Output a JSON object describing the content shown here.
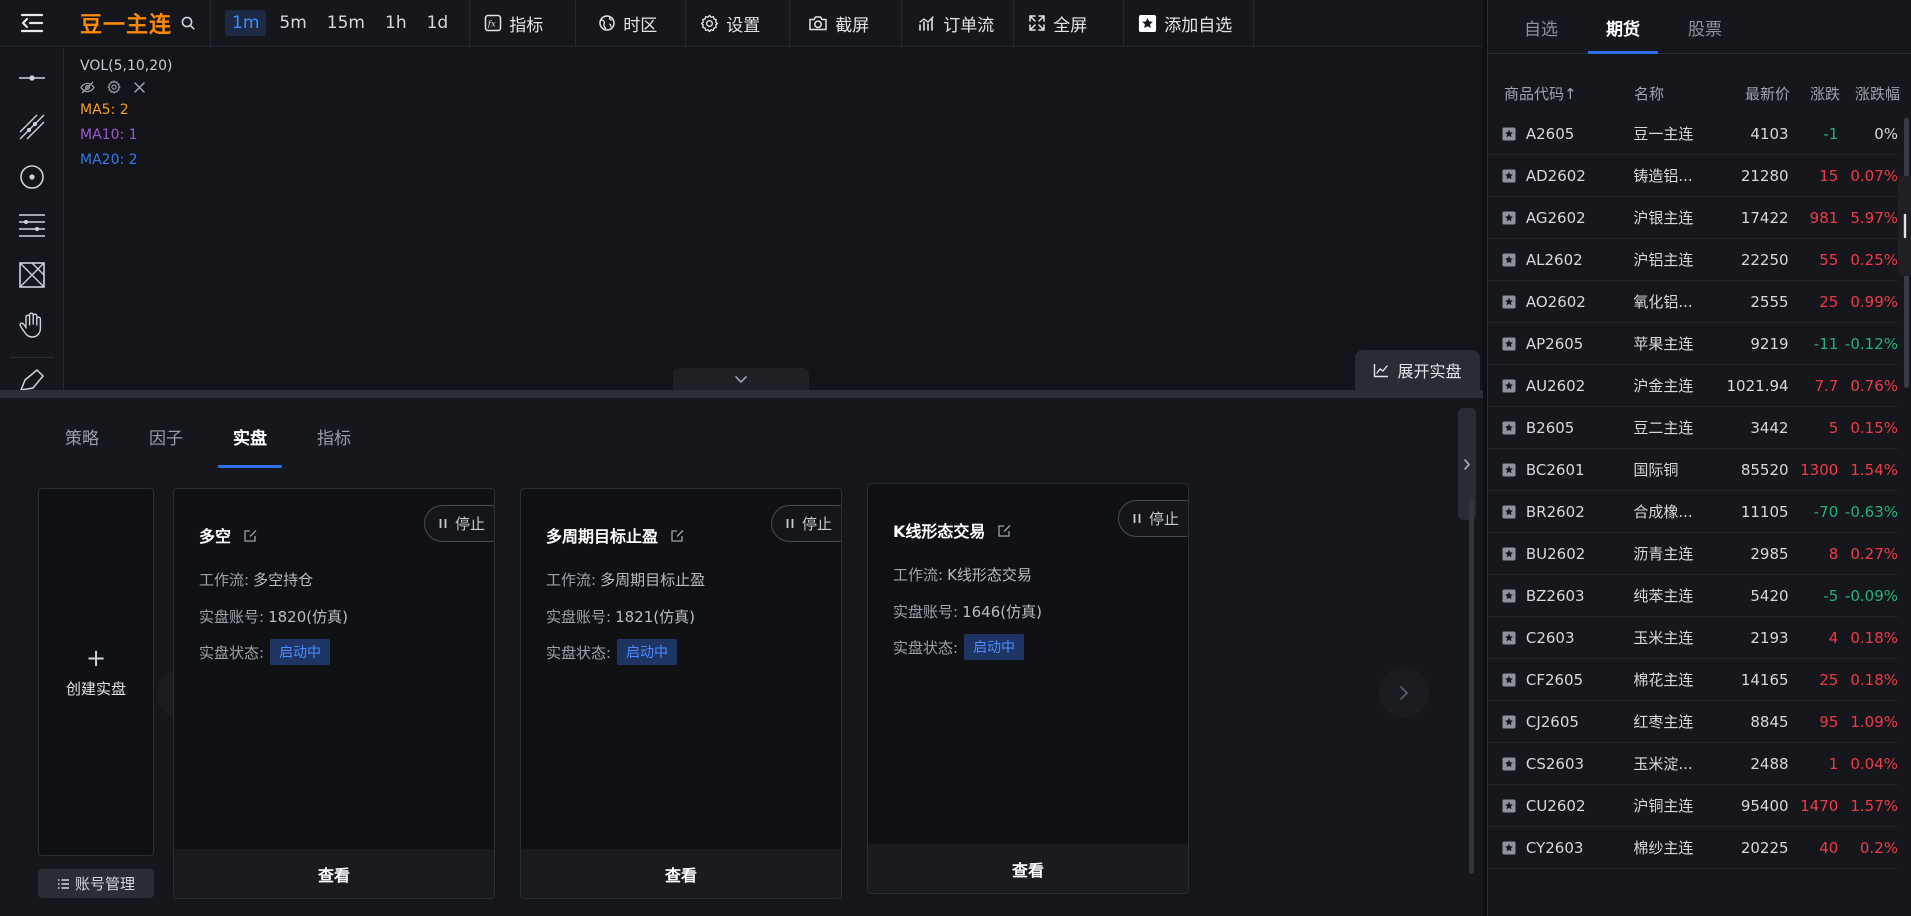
{
  "toolbar": {
    "symbol": "豆一主连",
    "intervals": [
      {
        "label": "1m",
        "active": true
      },
      {
        "label": "5m",
        "active": false
      },
      {
        "label": "15m",
        "active": false
      },
      {
        "label": "1h",
        "active": false
      },
      {
        "label": "1d",
        "active": false
      }
    ],
    "indicator_label": "指标",
    "timezone_label": "时区",
    "settings_label": "设置",
    "screenshot_label": "截屏",
    "orderflow_label": "订单流",
    "fullscreen_label": "全屏",
    "add_watch_label": "添加自选"
  },
  "chart": {
    "vol_title": "VOL(5,10,20)",
    "ma5": "MA5: 2",
    "ma10": "MA10: 1",
    "ma20": "MA20: 2",
    "ma5_color": "#ff9d1c",
    "ma10_color": "#9b59d0",
    "ma20_color": "#2f7be8",
    "expand_label": "展开实盘"
  },
  "bottom": {
    "tabs": [
      {
        "label": "策略",
        "active": false
      },
      {
        "label": "因子",
        "active": false
      },
      {
        "label": "实盘",
        "active": true
      },
      {
        "label": "指标",
        "active": false
      }
    ],
    "create_label": "创建实盘",
    "create_plus": "+",
    "account_label": "账号管理",
    "cards": [
      {
        "title": "多空",
        "stop": "停止",
        "workflow_label": "工作流:",
        "workflow": "多空持仓",
        "account_label": "实盘账号:",
        "account": "1820(仿真)",
        "status_label": "实盘状态:",
        "status": "启动中",
        "view": "查看"
      },
      {
        "title": "多周期目标止盈",
        "stop": "停止",
        "workflow_label": "工作流:",
        "workflow": "多周期目标止盈",
        "account_label": "实盘账号:",
        "account": "1821(仿真)",
        "status_label": "实盘状态:",
        "status": "启动中",
        "view": "查看"
      },
      {
        "title": "K线形态交易",
        "stop": "停止",
        "workflow_label": "工作流:",
        "workflow": "K线形态交易",
        "account_label": "实盘账号:",
        "account": "1646(仿真)",
        "status_label": "实盘状态:",
        "status": "启动中",
        "view": "查看"
      }
    ]
  },
  "right": {
    "tabs": [
      {
        "label": "自选",
        "active": false
      },
      {
        "label": "期货",
        "active": true
      },
      {
        "label": "股票",
        "active": false
      }
    ],
    "headers": {
      "code": "商品代码↑",
      "name": "名称",
      "price": "最新价",
      "change": "涨跌",
      "pct": "涨跌幅"
    },
    "rows": [
      {
        "code": "A2605",
        "name": "豆一主连",
        "price": "4103",
        "change": "-1",
        "pct": "0%",
        "dir": "down",
        "pct_dir": "neutral"
      },
      {
        "code": "AD2602",
        "name": "铸造铝...",
        "price": "21280",
        "change": "15",
        "pct": "0.07%",
        "dir": "up",
        "pct_dir": "up"
      },
      {
        "code": "AG2602",
        "name": "沪银主连",
        "price": "17422",
        "change": "981",
        "pct": "5.97%",
        "dir": "up",
        "pct_dir": "up"
      },
      {
        "code": "AL2602",
        "name": "沪铝主连",
        "price": "22250",
        "change": "55",
        "pct": "0.25%",
        "dir": "up",
        "pct_dir": "up"
      },
      {
        "code": "AO2602",
        "name": "氧化铝...",
        "price": "2555",
        "change": "25",
        "pct": "0.99%",
        "dir": "up",
        "pct_dir": "up"
      },
      {
        "code": "AP2605",
        "name": "苹果主连",
        "price": "9219",
        "change": "-11",
        "pct": "-0.12%",
        "dir": "down",
        "pct_dir": "down"
      },
      {
        "code": "AU2602",
        "name": "沪金主连",
        "price": "1021.94",
        "change": "7.7",
        "pct": "0.76%",
        "dir": "up",
        "pct_dir": "up"
      },
      {
        "code": "B2605",
        "name": "豆二主连",
        "price": "3442",
        "change": "5",
        "pct": "0.15%",
        "dir": "up",
        "pct_dir": "up"
      },
      {
        "code": "BC2601",
        "name": "国际铜",
        "price": "85520",
        "change": "1300",
        "pct": "1.54%",
        "dir": "up",
        "pct_dir": "up"
      },
      {
        "code": "BR2602",
        "name": "合成橡...",
        "price": "11105",
        "change": "-70",
        "pct": "-0.63%",
        "dir": "down",
        "pct_dir": "down"
      },
      {
        "code": "BU2602",
        "name": "沥青主连",
        "price": "2985",
        "change": "8",
        "pct": "0.27%",
        "dir": "up",
        "pct_dir": "up"
      },
      {
        "code": "BZ2603",
        "name": "纯苯主连",
        "price": "5420",
        "change": "-5",
        "pct": "-0.09%",
        "dir": "down",
        "pct_dir": "down"
      },
      {
        "code": "C2603",
        "name": "玉米主连",
        "price": "2193",
        "change": "4",
        "pct": "0.18%",
        "dir": "up",
        "pct_dir": "up"
      },
      {
        "code": "CF2605",
        "name": "棉花主连",
        "price": "14165",
        "change": "25",
        "pct": "0.18%",
        "dir": "up",
        "pct_dir": "up"
      },
      {
        "code": "CJ2605",
        "name": "红枣主连",
        "price": "8845",
        "change": "95",
        "pct": "1.09%",
        "dir": "up",
        "pct_dir": "up"
      },
      {
        "code": "CS2603",
        "name": "玉米淀...",
        "price": "2488",
        "change": "1",
        "pct": "0.04%",
        "dir": "up",
        "pct_dir": "up"
      },
      {
        "code": "CU2602",
        "name": "沪铜主连",
        "price": "95400",
        "change": "1470",
        "pct": "1.57%",
        "dir": "up",
        "pct_dir": "up"
      },
      {
        "code": "CY2603",
        "name": "棉纱主连",
        "price": "20225",
        "change": "40",
        "pct": "0.2%",
        "dir": "up",
        "pct_dir": "up"
      }
    ]
  }
}
